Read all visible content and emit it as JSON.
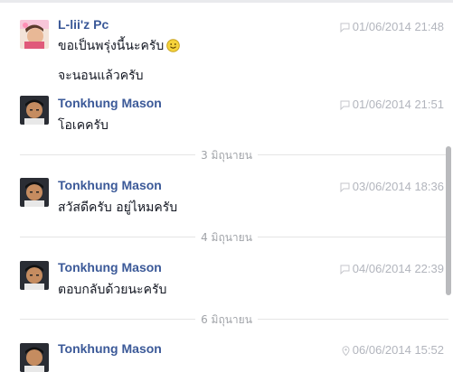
{
  "conversation": {
    "messages": [
      {
        "sender": "L-lii'z Pc",
        "timestamp": "01/06/2014 21:48",
        "lines": [
          "ขอเป็นพรุ่งนี้นะครับ",
          "จะนอนแล้วครับ"
        ],
        "emoji": "smiley"
      },
      {
        "sender": "Tonkhung Mason",
        "timestamp": "01/06/2014 21:51",
        "lines": [
          "โอเคครับ"
        ]
      },
      {
        "sender": "Tonkhung Mason",
        "timestamp": "03/06/2014 18:36",
        "lines": [
          "สวัสดีครับ อยู่ไหมครับ"
        ]
      },
      {
        "sender": "Tonkhung Mason",
        "timestamp": "04/06/2014 22:39",
        "lines": [
          "ตอบกลับด้วยนะครับ"
        ]
      },
      {
        "sender": "Tonkhung Mason",
        "timestamp": "06/06/2014 15:52",
        "lines": []
      }
    ],
    "separators": [
      "3 มิถุนายน",
      "4 มิถุนายน",
      "6 มิถุนายน"
    ]
  },
  "icons": {
    "timestamp_icon": "chat-bubble-icon",
    "location_icon": "location-pin-icon",
    "emoji": "smiley-icon"
  },
  "colors": {
    "sender_name": "#3b5998",
    "timestamp": "#b2b5bd",
    "separator_text": "#a0a3a8"
  }
}
